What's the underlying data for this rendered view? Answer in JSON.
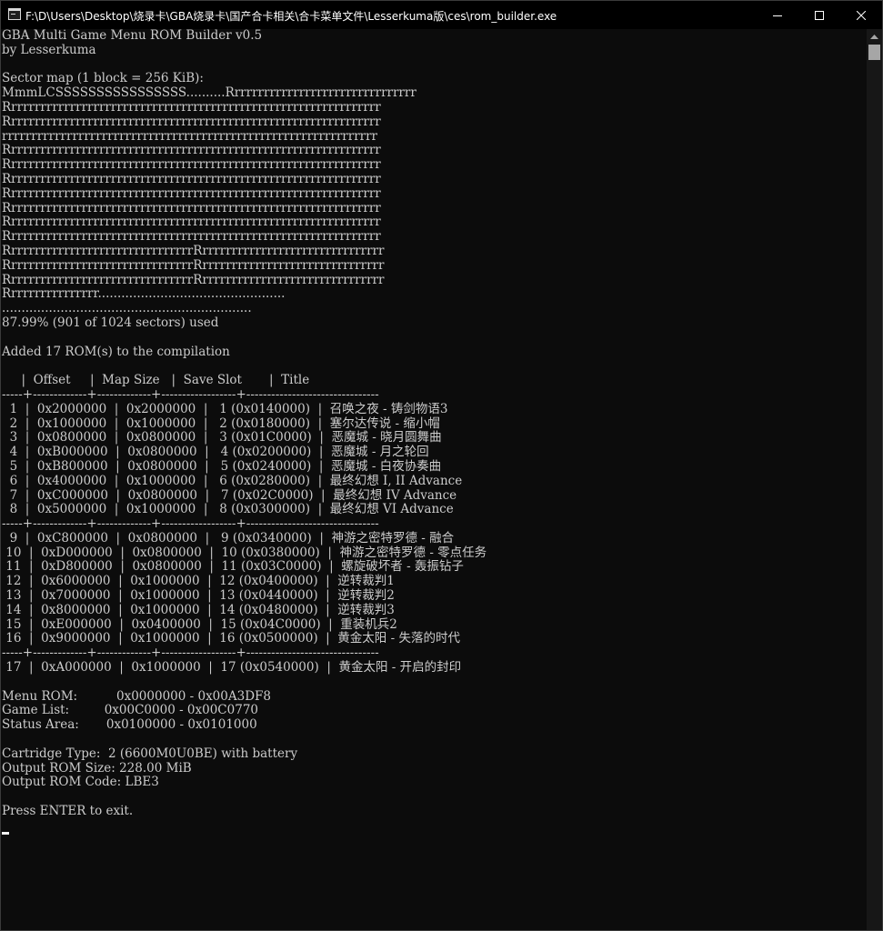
{
  "window": {
    "title": "F:\\D\\Users\\Desktop\\烧录卡\\GBA烧录卡\\国产合卡相关\\合卡菜单文件\\Lesserkuma版\\ces\\rom_builder.exe",
    "buttons": {
      "minimize": "—",
      "maximize": "☐",
      "close": "✕"
    }
  },
  "console": {
    "lines": [
      "GBA Multi Game Menu ROM Builder v0.5",
      "by Lesserkuma",
      "",
      "Sector map (1 block = 256 KiB):",
      "MmmLCSSSSSSSSSSSSSSSS..........Rrrrrrrrrrrrrrrrrrrrrrrrrrrrrrrr",
      "Rrrrrrrrrrrrrrrrrrrrrrrrrrrrrrrrrrrrrrrrrrrrrrrrrrrrrrrrrrrrrrrr",
      "Rrrrrrrrrrrrrrrrrrrrrrrrrrrrrrrrrrrrrrrrrrrrrrrrrrrrrrrrrrrrrrrr",
      "rrrrrrrrrrrrrrrrrrrrrrrrrrrrrrrrrrrrrrrrrrrrrrrrrrrrrrrrrrrrrrrr",
      "Rrrrrrrrrrrrrrrrrrrrrrrrrrrrrrrrrrrrrrrrrrrrrrrrrrrrrrrrrrrrrrrr",
      "Rrrrrrrrrrrrrrrrrrrrrrrrrrrrrrrrrrrrrrrrrrrrrrrrrrrrrrrrrrrrrrrr",
      "Rrrrrrrrrrrrrrrrrrrrrrrrrrrrrrrrrrrrrrrrrrrrrrrrrrrrrrrrrrrrrrrr",
      "Rrrrrrrrrrrrrrrrrrrrrrrrrrrrrrrrrrrrrrrrrrrrrrrrrrrrrrrrrrrrrrrr",
      "Rrrrrrrrrrrrrrrrrrrrrrrrrrrrrrrrrrrrrrrrrrrrrrrrrrrrrrrrrrrrrrrr",
      "Rrrrrrrrrrrrrrrrrrrrrrrrrrrrrrrrrrrrrrrrrrrrrrrrrrrrrrrrrrrrrrrr",
      "Rrrrrrrrrrrrrrrrrrrrrrrrrrrrrrrrrrrrrrrrrrrrrrrrrrrrrrrrrrrrrrrr",
      "RrrrrrrrrrrrrrrrrrrrrrrrrrrrrrrrRrrrrrrrrrrrrrrrrrrrrrrrrrrrrrrr",
      "RrrrrrrrrrrrrrrrrrrrrrrrrrrrrrrrRrrrrrrrrrrrrrrrrrrrrrrrrrrrrrrr",
      "RrrrrrrrrrrrrrrrrrrrrrrrrrrrrrrrRrrrrrrrrrrrrrrrrrrrrrrrrrrrrrrr",
      "Rrrrrrrrrrrrrrrr................................................",
      "................................................................",
      "87.99% (901 of 1024 sectors) used",
      "",
      "Added 17 ROM(s) to the compilation",
      "",
      "     |  Offset     |  Map Size   |  Save Slot       |  Title",
      "-----+-------------+-------------+------------------+--------------------------------",
      "  1  |  0x2000000  |  0x2000000  |   1 (0x0140000)  |  召唤之夜 - 铸剑物语3",
      "  2  |  0x1000000  |  0x1000000  |   2 (0x0180000)  |  塞尔达传说 - 缩小帽",
      "  3  |  0x0800000  |  0x0800000  |   3 (0x01C0000)  |  恶魔城 - 晓月圆舞曲",
      "  4  |  0xB000000  |  0x0800000  |   4 (0x0200000)  |  恶魔城 - 月之轮回",
      "  5  |  0xB800000  |  0x0800000  |   5 (0x0240000)  |  恶魔城 - 白夜协奏曲",
      "  6  |  0x4000000  |  0x1000000  |   6 (0x0280000)  |  最终幻想 I, II Advance",
      "  7  |  0xC000000  |  0x0800000  |   7 (0x02C0000)  |  最终幻想 IV Advance",
      "  8  |  0x5000000  |  0x1000000  |   8 (0x0300000)  |  最终幻想 VI Advance",
      "-----+-------------+-------------+------------------+--------------------------------",
      "  9  |  0xC800000  |  0x0800000  |   9 (0x0340000)  |  神游之密特罗德 - 融合",
      " 10  |  0xD000000  |  0x0800000  |  10 (0x0380000)  |  神游之密特罗德 - 零点任务",
      " 11  |  0xD800000  |  0x0800000  |  11 (0x03C0000)  |  螺旋破坏者 - 轰振钻子",
      " 12  |  0x6000000  |  0x1000000  |  12 (0x0400000)  |  逆转裁判1",
      " 13  |  0x7000000  |  0x1000000  |  13 (0x0440000)  |  逆转裁判2",
      " 14  |  0x8000000  |  0x1000000  |  14 (0x0480000)  |  逆转裁判3",
      " 15  |  0xE000000  |  0x0400000  |  15 (0x04C0000)  |  重装机兵2",
      " 16  |  0x9000000  |  0x1000000  |  16 (0x0500000)  |  黄金太阳 - 失落的时代",
      "-----+-------------+-------------+------------------+--------------------------------",
      " 17  |  0xA000000  |  0x1000000  |  17 (0x0540000)  |  黄金太阳 - 开启的封印",
      "",
      "Menu ROM:          0x0000000 - 0x00A3DF8",
      "Game List:         0x00C0000 - 0x00C0770",
      "Status Area:       0x0100000 - 0x0101000",
      "",
      "Cartridge Type:  2 (6600M0U0BE) with battery",
      "Output ROM Size: 228.00 MiB",
      "Output ROM Code: LBE3",
      "",
      "Press ENTER to exit."
    ]
  }
}
